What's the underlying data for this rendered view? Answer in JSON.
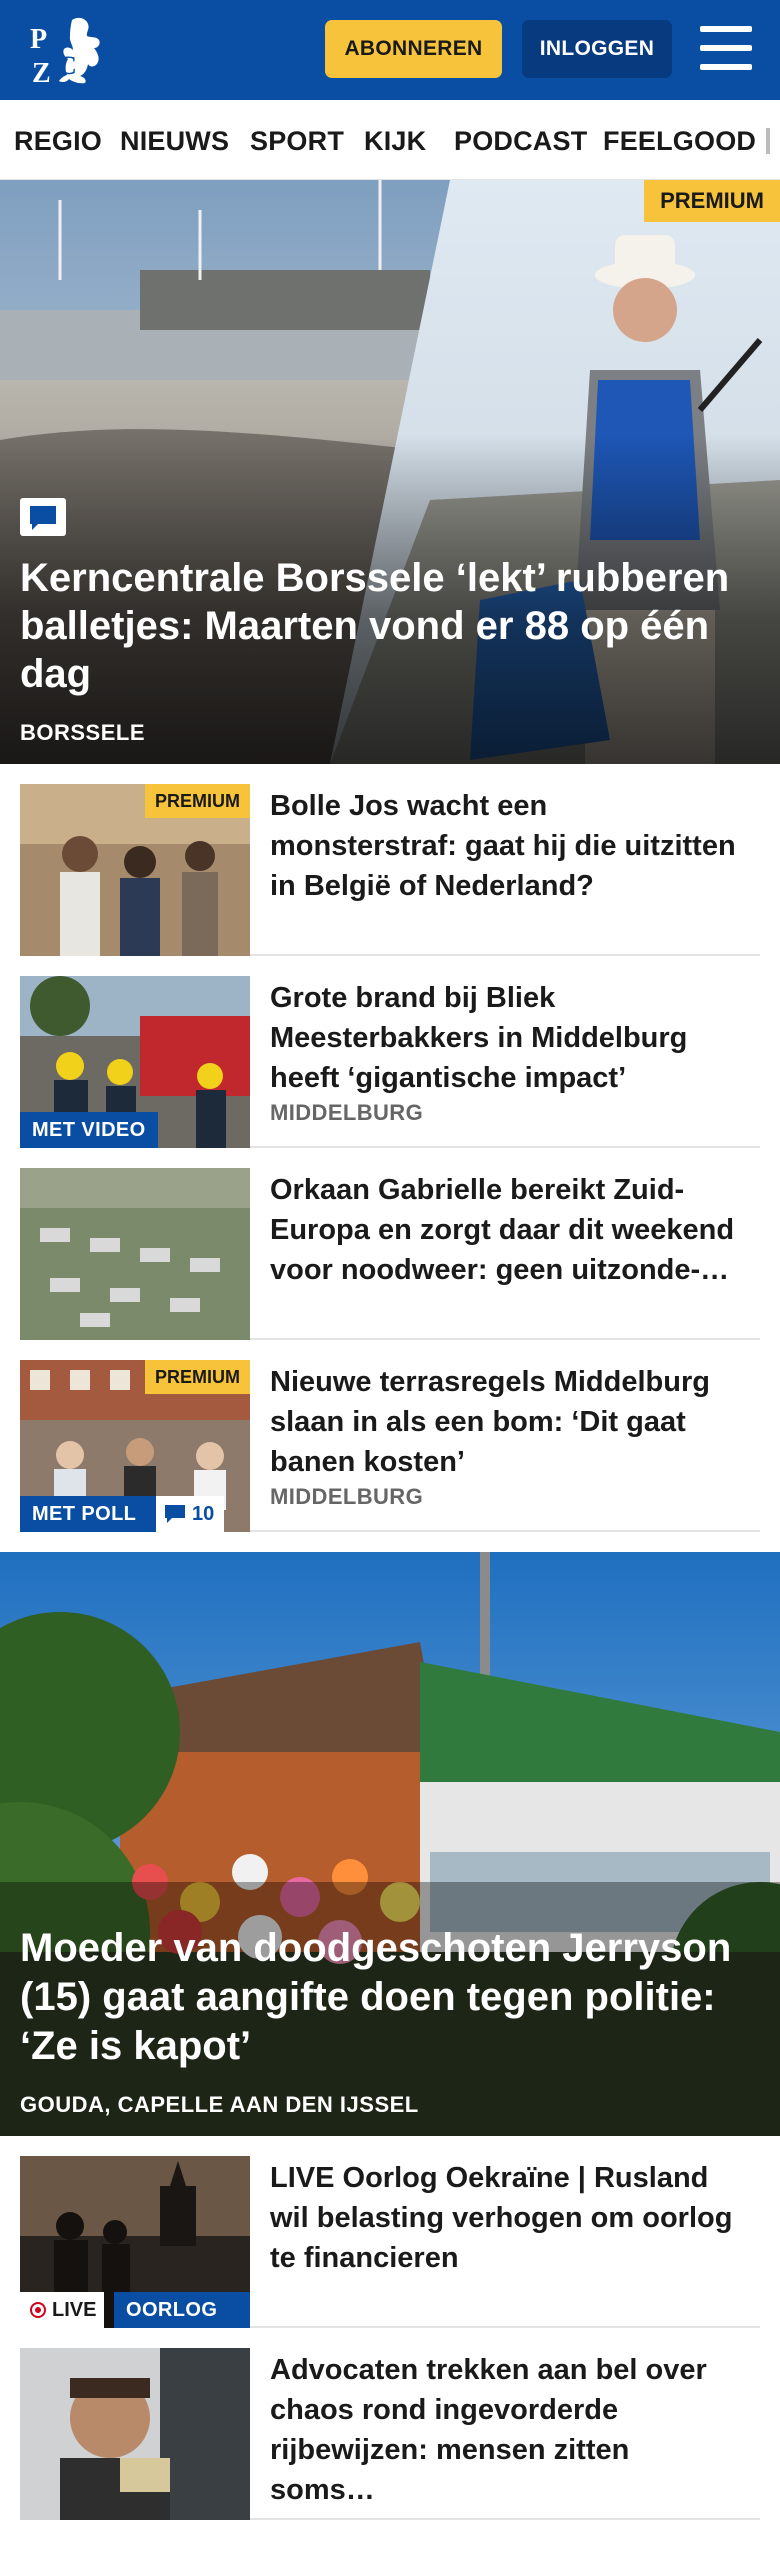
{
  "brand": {
    "logo_text": "PZC",
    "accent": "#0a4ea3",
    "premium_color": "#f6c33a"
  },
  "header": {
    "subscribe_label": "ABONNEREN",
    "login_label": "INLOGGEN",
    "menu_icon": "hamburger-menu-icon"
  },
  "nav": {
    "items": [
      {
        "label": "REGIO"
      },
      {
        "label": "NIEUWS"
      },
      {
        "label": "SPORT"
      },
      {
        "label": "KIJK"
      },
      {
        "label": "PODCAST"
      },
      {
        "label": "FEELGOOD"
      }
    ]
  },
  "hero": {
    "badge": "PREMIUM",
    "icon": "comment-icon",
    "title": "Kerncentrale Borssele ‘lekt’ rubberen balletjes: Maarten vond er 88 op één dag",
    "location": "BORSSELE"
  },
  "articles": [
    {
      "badge": "PREMIUM",
      "title": "Bolle Jos wacht een monsterstraf: gaat hij die uitzitten in België of Nederland?",
      "location": ""
    },
    {
      "media_tag": "MET VIDEO",
      "title": "Grote brand bij Bliek Meesterbakkers in Middelburg heeft ‘gigantische impact’",
      "location": "MIDDELBURG"
    },
    {
      "title": "Orkaan Gabrielle bereikt Zuid-Europa en zorgt daar dit weekend voor noodweer: geen uitzonde-…",
      "location": ""
    },
    {
      "badge": "PREMIUM",
      "media_tag": "MET POLL",
      "comment_count": "10",
      "title": "Nieuwe terrasregels Middelburg slaan in als een bom: ‘Dit gaat banen kosten’",
      "location": "MIDDELBURG"
    }
  ],
  "feature": {
    "title": "Moeder van doodgeschoten Jerryson (15) gaat aangifte doen tegen politie: ‘Ze is kapot’",
    "location": "GOUDA, CAPELLE AAN DEN IJSSEL"
  },
  "articles2": [
    {
      "live_label": "LIVE",
      "media_tag": "OORLOG …",
      "title": "LIVE Oorlog Oekraïne | Rusland wil belasting verhogen om oorlog te financieren"
    },
    {
      "title": "Advocaten trekken aan bel over chaos rond ingevorderde rijbewijzen: mensen zitten soms…"
    }
  ]
}
